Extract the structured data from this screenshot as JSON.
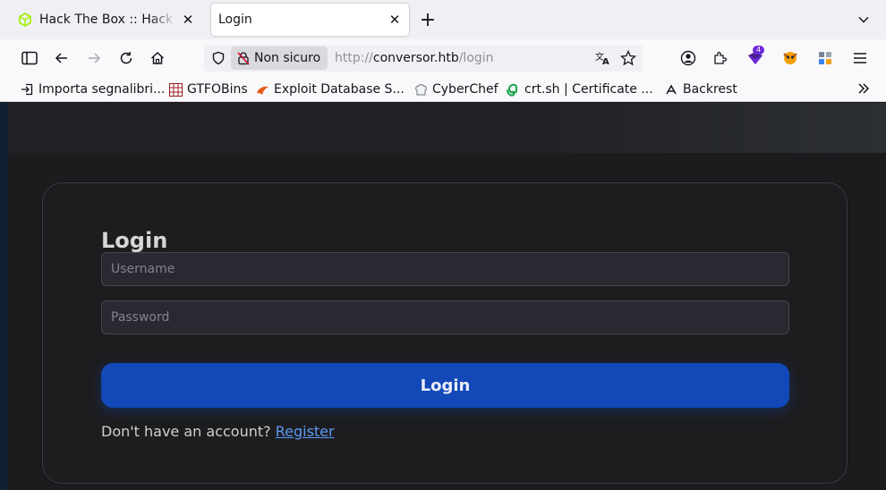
{
  "browser": {
    "tabs": [
      {
        "title": "Hack The Box :: Hack The Box",
        "active": false
      },
      {
        "title": "Login",
        "active": true
      }
    ],
    "address_bar": {
      "security_label": "Non sicuro",
      "url_scheme": "http://",
      "url_host": "conversor.htb",
      "url_path": "/login"
    },
    "extensions_badge": "4",
    "bookmarks": [
      {
        "label": "Importa segnalibri...",
        "icon": "import-icon"
      },
      {
        "label": "GTFOBins",
        "icon": "gtfobins-icon"
      },
      {
        "label": "Exploit Database S...",
        "icon": "exploit-db-icon"
      },
      {
        "label": "CyberChef",
        "icon": "cyberchef-icon"
      },
      {
        "label": "crt.sh | Certificate ...",
        "icon": "crtsh-icon"
      },
      {
        "label": "Backrest",
        "icon": "backrest-icon"
      }
    ]
  },
  "page": {
    "title": "Login",
    "username_placeholder": "Username",
    "password_placeholder": "Password",
    "login_button": "Login",
    "no_account_text": "Don't have an account?",
    "register_link": "Register"
  },
  "colors": {
    "accent": "#1248b8",
    "link": "#5b9bf2",
    "page_background": "#1c1c1f",
    "htb_green": "#9fef00"
  }
}
